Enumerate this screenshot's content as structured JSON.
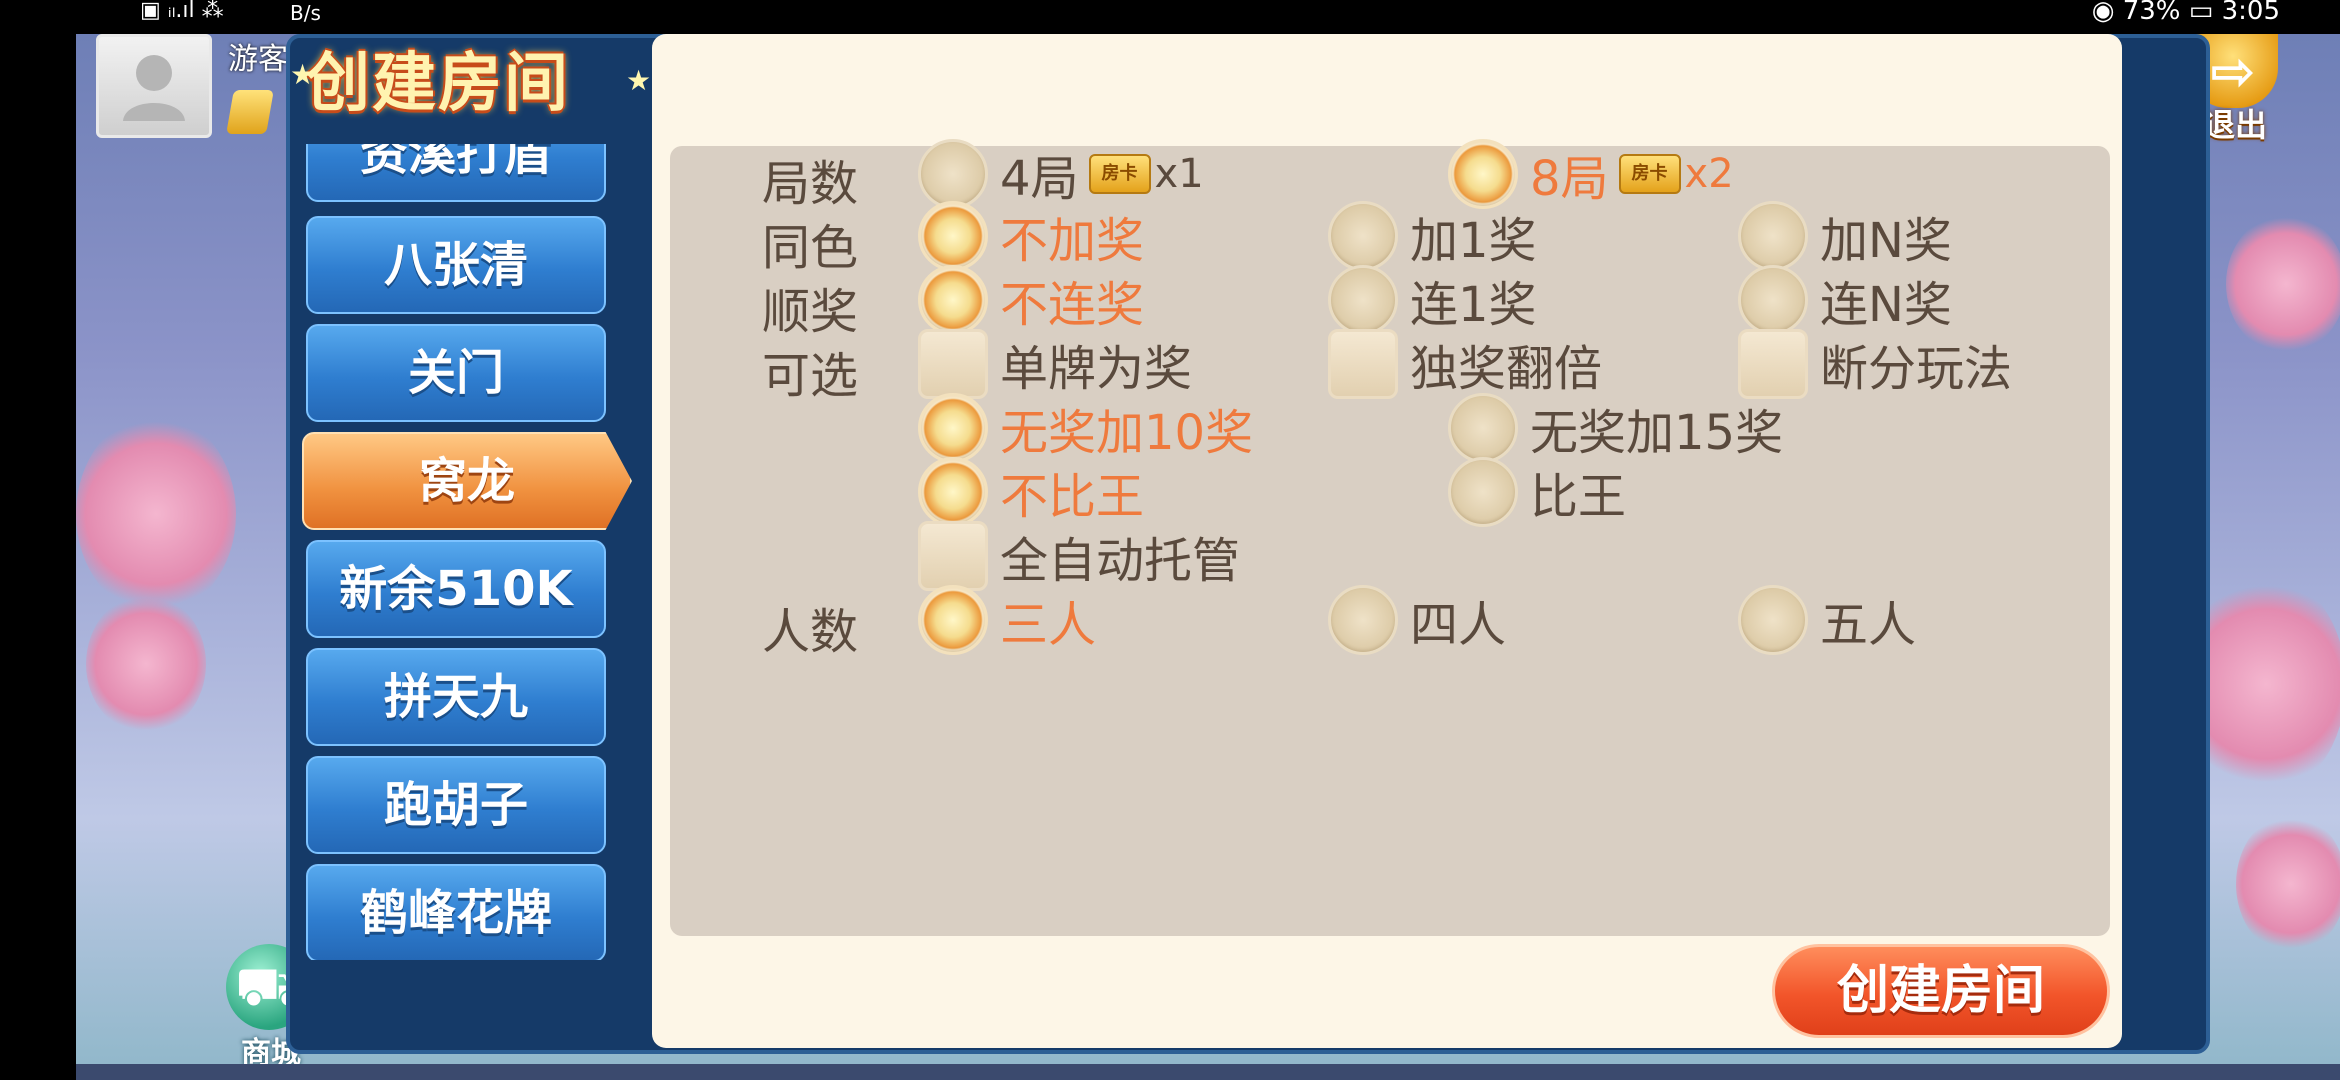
{
  "status_bar": {
    "left_text": "▣ ᵢₗ.ıl ⁂",
    "speed": "B/s",
    "right_text": "◉ 73% ▭ 3:05"
  },
  "hud": {
    "guest_label": "游客",
    "exit_label": "退出",
    "shop_label": "商城"
  },
  "dialog": {
    "title": "创建房间",
    "create_button_label": "创建房间",
    "game_list": [
      {
        "label": "资溪打盾",
        "active": false
      },
      {
        "label": "八张清",
        "active": false
      },
      {
        "label": "关门",
        "active": false
      },
      {
        "label": "窝龙",
        "active": true
      },
      {
        "label": "新余510K",
        "active": false
      },
      {
        "label": "拼天九",
        "active": false
      },
      {
        "label": "跑胡子",
        "active": false
      },
      {
        "label": "鹤峰花牌",
        "active": false
      }
    ],
    "rows": {
      "rounds": {
        "label": "局数",
        "options": [
          {
            "text": "4局",
            "badge": "房卡",
            "mult": "x1",
            "selected": false
          },
          {
            "text": "8局",
            "badge": "房卡",
            "mult": "x2",
            "selected": true
          }
        ]
      },
      "same_color": {
        "label": "同色",
        "options": [
          {
            "text": "不加奖",
            "selected": true
          },
          {
            "text": "加1奖",
            "selected": false
          },
          {
            "text": "加N奖",
            "selected": false
          }
        ]
      },
      "straight": {
        "label": "顺奖",
        "options": [
          {
            "text": "不连奖",
            "selected": true
          },
          {
            "text": "连1奖",
            "selected": false
          },
          {
            "text": "连N奖",
            "selected": false
          }
        ]
      },
      "optional": {
        "label": "可选",
        "checks": [
          {
            "text": "单牌为奖",
            "checked": false
          },
          {
            "text": "独奖翻倍",
            "checked": false
          },
          {
            "text": "断分玩法",
            "checked": false
          }
        ],
        "no_bonus": [
          {
            "text": "无奖加10奖",
            "selected": true
          },
          {
            "text": "无奖加15奖",
            "selected": false
          }
        ],
        "king": [
          {
            "text": "不比王",
            "selected": true
          },
          {
            "text": "比王",
            "selected": false
          }
        ],
        "auto": {
          "text": "全自动托管",
          "checked": false
        }
      },
      "players": {
        "label": "人数",
        "options": [
          {
            "text": "三人",
            "selected": true
          },
          {
            "text": "四人",
            "selected": false
          },
          {
            "text": "五人",
            "selected": false
          }
        ]
      }
    }
  },
  "colors": {
    "selected_text": "#ef7a3d",
    "normal_text": "#5a4a3d",
    "panel_bg": "#fdf6e7",
    "options_bg": "#d9cfc3",
    "tab_blue": "#2f7ed0",
    "tab_orange": "#f0913f"
  },
  "icons": {
    "close": "close-icon",
    "exit": "exit-icon",
    "shop": "cart-icon",
    "avatar": "user-avatar-icon",
    "room_card": "room-card-icon"
  }
}
